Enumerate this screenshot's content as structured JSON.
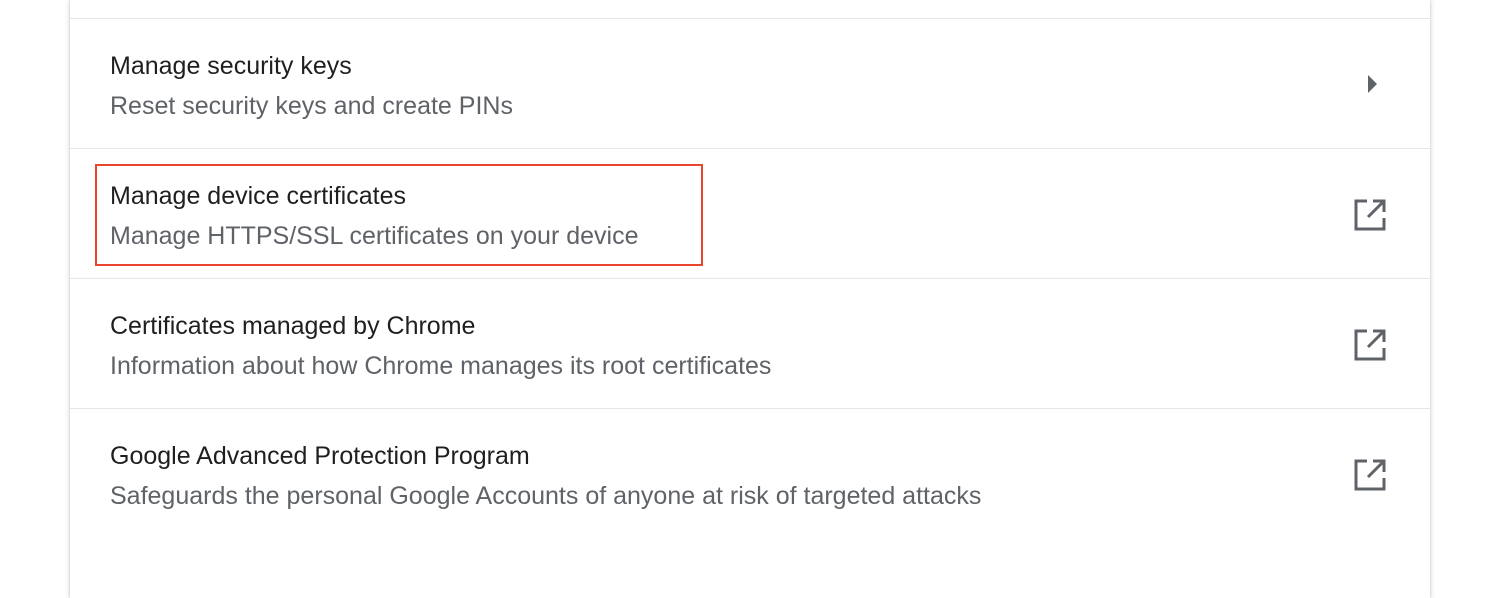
{
  "rows": [
    {
      "title": "Manage security keys",
      "subtitle": "Reset security keys and create PINs",
      "icon": "arrow-right-icon"
    },
    {
      "title": "Manage device certificates",
      "subtitle": "Manage HTTPS/SSL certificates on your device",
      "icon": "external-link-icon"
    },
    {
      "title": "Certificates managed by Chrome",
      "subtitle": "Information about how Chrome manages its root certificates",
      "icon": "external-link-icon"
    },
    {
      "title": "Google Advanced Protection Program",
      "subtitle": "Safeguards the personal Google Accounts of anyone at risk of targeted attacks",
      "icon": "external-link-icon"
    }
  ],
  "colors": {
    "highlight": "#e8452c",
    "title": "#1f1f1f",
    "subtitle": "#5f6368",
    "icon": "#5f6368"
  }
}
